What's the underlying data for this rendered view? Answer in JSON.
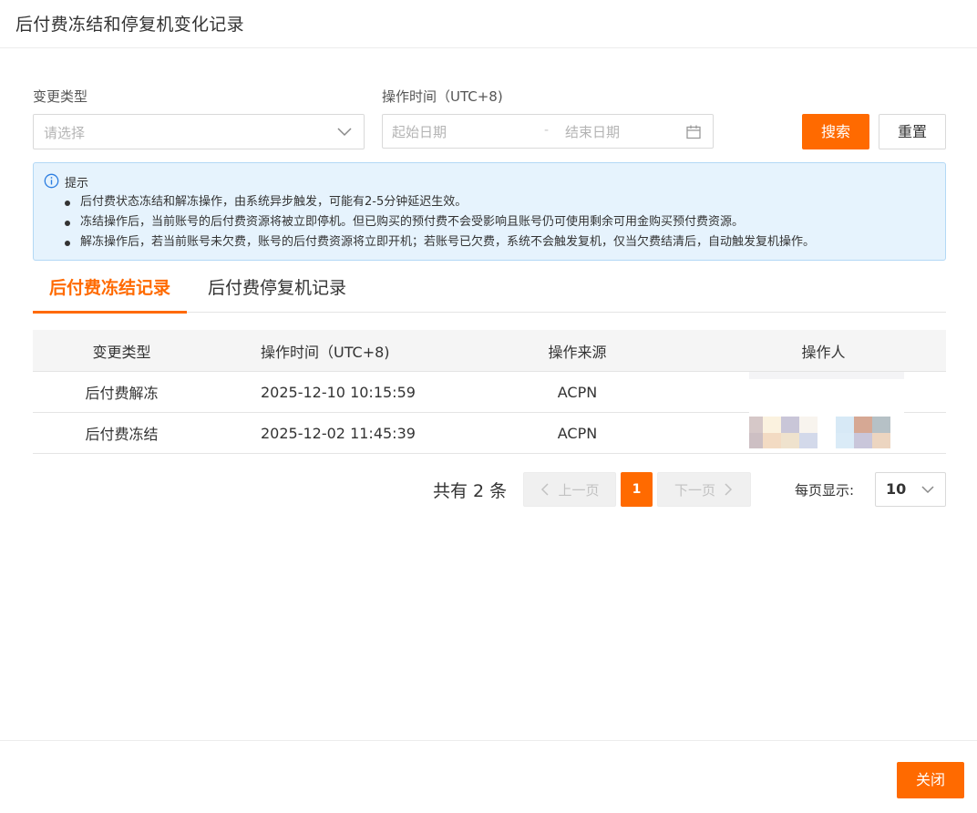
{
  "dialog": {
    "title": "后付费冻结和停复机变化记录"
  },
  "filters": {
    "change_type_label": "变更类型",
    "change_type_placeholder": "请选择",
    "op_time_label": "操作时间（UTC+8)",
    "start_date_placeholder": "起始日期",
    "end_date_placeholder": "结束日期",
    "separator": "-",
    "search_button": "搜索",
    "reset_button": "重置"
  },
  "tip": {
    "title": "提示",
    "items": [
      "后付费状态冻结和解冻操作，由系统异步触发，可能有2-5分钟延迟生效。",
      "冻结操作后，当前账号的后付费资源将被立即停机。但已购买的预付费不会受影响且账号仍可使用剩余可用金购买预付费资源。",
      "解冻操作后，若当前账号未欠费，账号的后付费资源将立即开机；若账号已欠费，系统不会触发复机，仅当欠费结清后，自动触发复机操作。"
    ]
  },
  "tabs": [
    {
      "label": "后付费冻结记录",
      "active": true
    },
    {
      "label": "后付费停复机记录",
      "active": false
    }
  ],
  "table": {
    "columns": [
      "变更类型",
      "操作时间（UTC+8)",
      "操作来源",
      "操作人"
    ],
    "rows": [
      {
        "type": "后付费解冻",
        "time": "2025-12-10 10:15:59",
        "source": "ACPN",
        "operator": ""
      },
      {
        "type": "后付费冻结",
        "time": "2025-12-02 11:45:39",
        "source": "ACPN",
        "operator": ""
      }
    ]
  },
  "pagination": {
    "total_text": "共有 2 条",
    "prev_label": "上一页",
    "next_label": "下一页",
    "current_page": "1",
    "page_size_label": "每页显示:",
    "page_size_value": "10"
  },
  "footer": {
    "close_button": "关闭"
  },
  "colors": {
    "accent": "#ff6a00",
    "tip_bg": "#e6f3fd",
    "tip_border": "#b3d8f5",
    "info_blue": "#2b7de1"
  }
}
